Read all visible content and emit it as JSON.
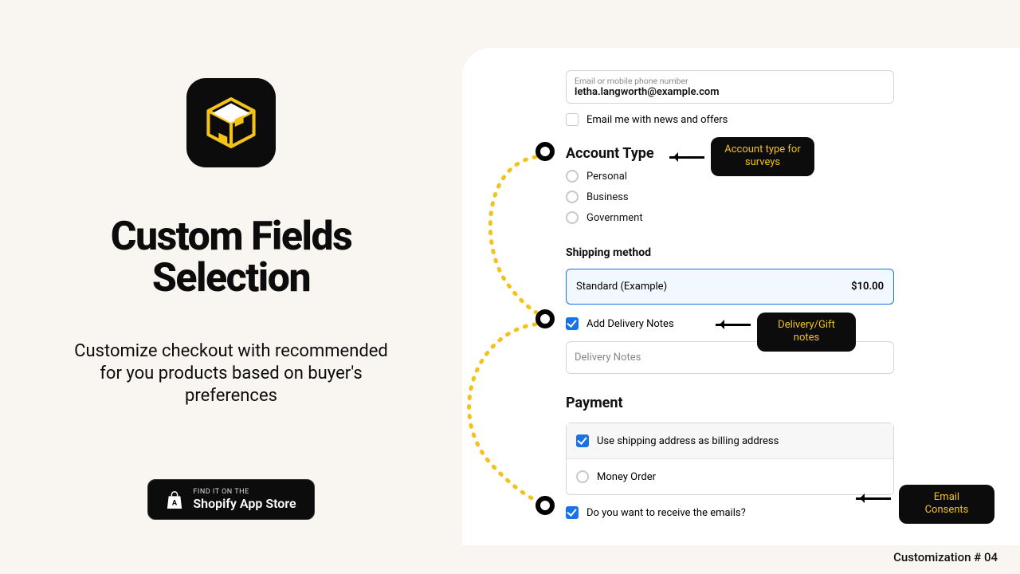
{
  "left": {
    "title_l1": "Custom Fields",
    "title_l2": "Selection",
    "subtitle": "Customize checkout with recommended for you products based on buyer's preferences",
    "badge_small": "FIND IT ON THE",
    "badge_big": "Shopify App Store"
  },
  "email": {
    "label": "Email or mobile phone number",
    "value": "letha.langworth@example.com"
  },
  "newsletter": "Email me with news and offers",
  "account": {
    "heading": "Account Type",
    "options": {
      "o0": "Personal",
      "o1": "Business",
      "o2": "Government"
    }
  },
  "shipping": {
    "heading": "Shipping method",
    "name": "Standard (Example)",
    "price": "$10.00"
  },
  "delivery": {
    "toggle": "Add Delivery Notes",
    "placeholder": "Delivery Notes"
  },
  "payment": {
    "heading": "Payment",
    "use_shipping": "Use shipping address as billing address",
    "money_order": "Money Order"
  },
  "consent": "Do you want to receive the emails?",
  "callouts": {
    "c1": "Account type for surveys",
    "c2": "Delivery/Gift notes",
    "c3": "Email Consents"
  },
  "footer": "Customization # 04"
}
